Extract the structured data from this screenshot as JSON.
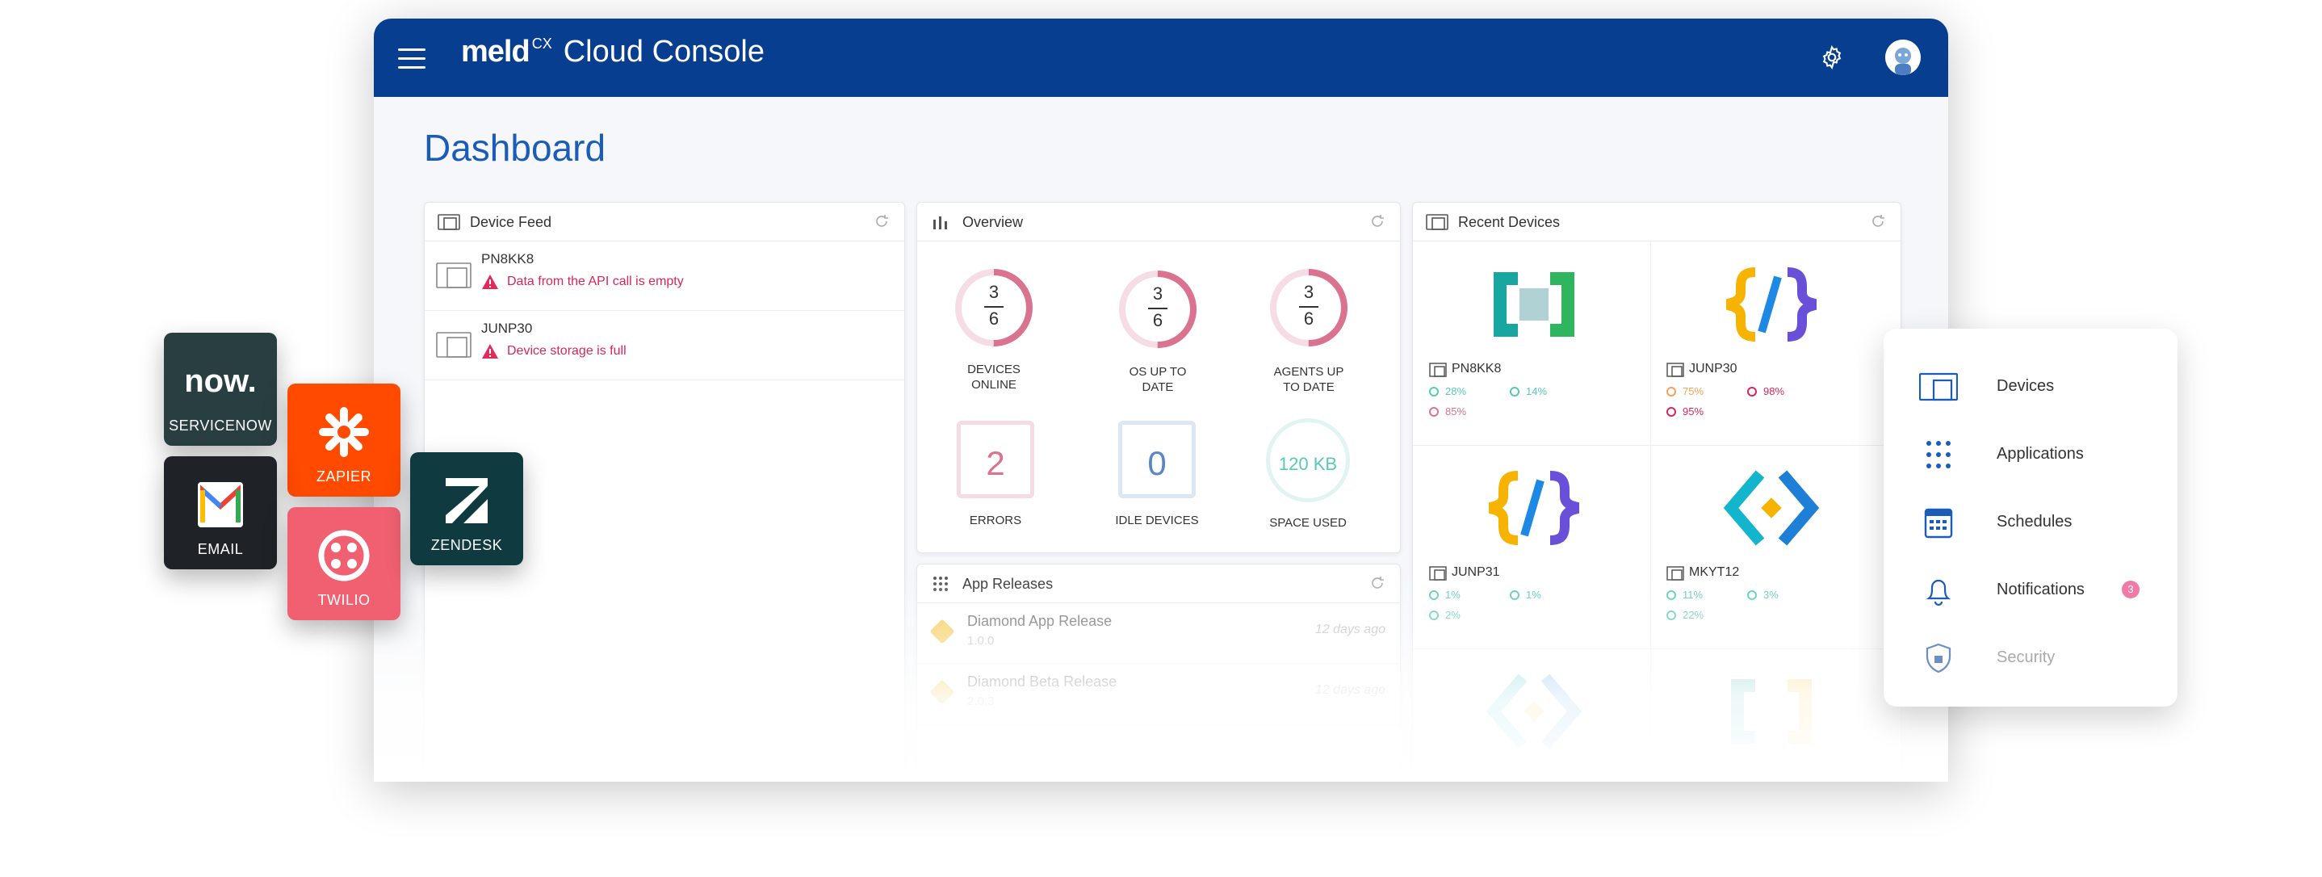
{
  "app": {
    "brand_logo": "meld",
    "brand_superscript": "CX",
    "brand_title": "Cloud Console",
    "page_title": "Dashboard"
  },
  "device_feed": {
    "title": "Device Feed",
    "items": [
      {
        "name": "PN8KK8",
        "message": "Data from the API call is empty"
      },
      {
        "name": "JUNP30",
        "message": "Device storage is full"
      }
    ]
  },
  "overview": {
    "title": "Overview",
    "rings": [
      {
        "numerator": "3",
        "denominator": "6",
        "label_line1": "DEVICES",
        "label_line2": "ONLINE",
        "fraction": 0.5
      },
      {
        "numerator": "3",
        "denominator": "6",
        "label_line1": "OS UP TO",
        "label_line2": "DATE",
        "fraction": 0.5
      },
      {
        "numerator": "3",
        "denominator": "6",
        "label_line1": "AGENTS UP",
        "label_line2": "TO DATE",
        "fraction": 0.5
      }
    ],
    "errors": {
      "value": "2",
      "label": "ERRORS"
    },
    "idle": {
      "value": "0",
      "label": "IDLE DEVICES"
    },
    "space": {
      "value": "120 KB",
      "label": "SPACE USED"
    }
  },
  "app_releases": {
    "title": "App Releases",
    "items": [
      {
        "name": "Diamond App Release",
        "version": "1.0.0",
        "age": "12 days ago"
      },
      {
        "name": "Diamond Beta Release",
        "version": "2.0.3",
        "age": "12 days ago"
      }
    ]
  },
  "recent_devices": {
    "title": "Recent Devices",
    "items": [
      {
        "name": "PN8KK8",
        "cpu": "28%",
        "storage": "14%",
        "memory": "85%"
      },
      {
        "name": "JUNP30",
        "cpu": "75%",
        "storage": "98%",
        "memory": "95%"
      },
      {
        "name": "JUNP31",
        "cpu": "1%",
        "storage": "1%",
        "memory": "2%"
      },
      {
        "name": "MKYT12",
        "cpu": "11%",
        "storage": "3%",
        "memory": "22%"
      }
    ]
  },
  "integrations": {
    "servicenow_logo": "now.",
    "servicenow": "SERVICENOW",
    "zapier": "ZAPIER",
    "email": "EMAIL",
    "zendesk": "ZENDESK",
    "twilio": "TWILIO"
  },
  "side_menu": {
    "items": [
      "Devices",
      "Applications",
      "Schedules",
      "Notifications",
      "Security"
    ],
    "notifications_badge": "3"
  },
  "colors": {
    "topbar": "#073e8f",
    "title_blue": "#1a5cb8",
    "error_pink": "#d6265b",
    "teal": "#57c9b6",
    "orange": "#f3a25a",
    "zapier": "#ff4a00",
    "servicenow": "#293e40",
    "zendesk": "#03363d",
    "twilio": "#f22f46"
  }
}
